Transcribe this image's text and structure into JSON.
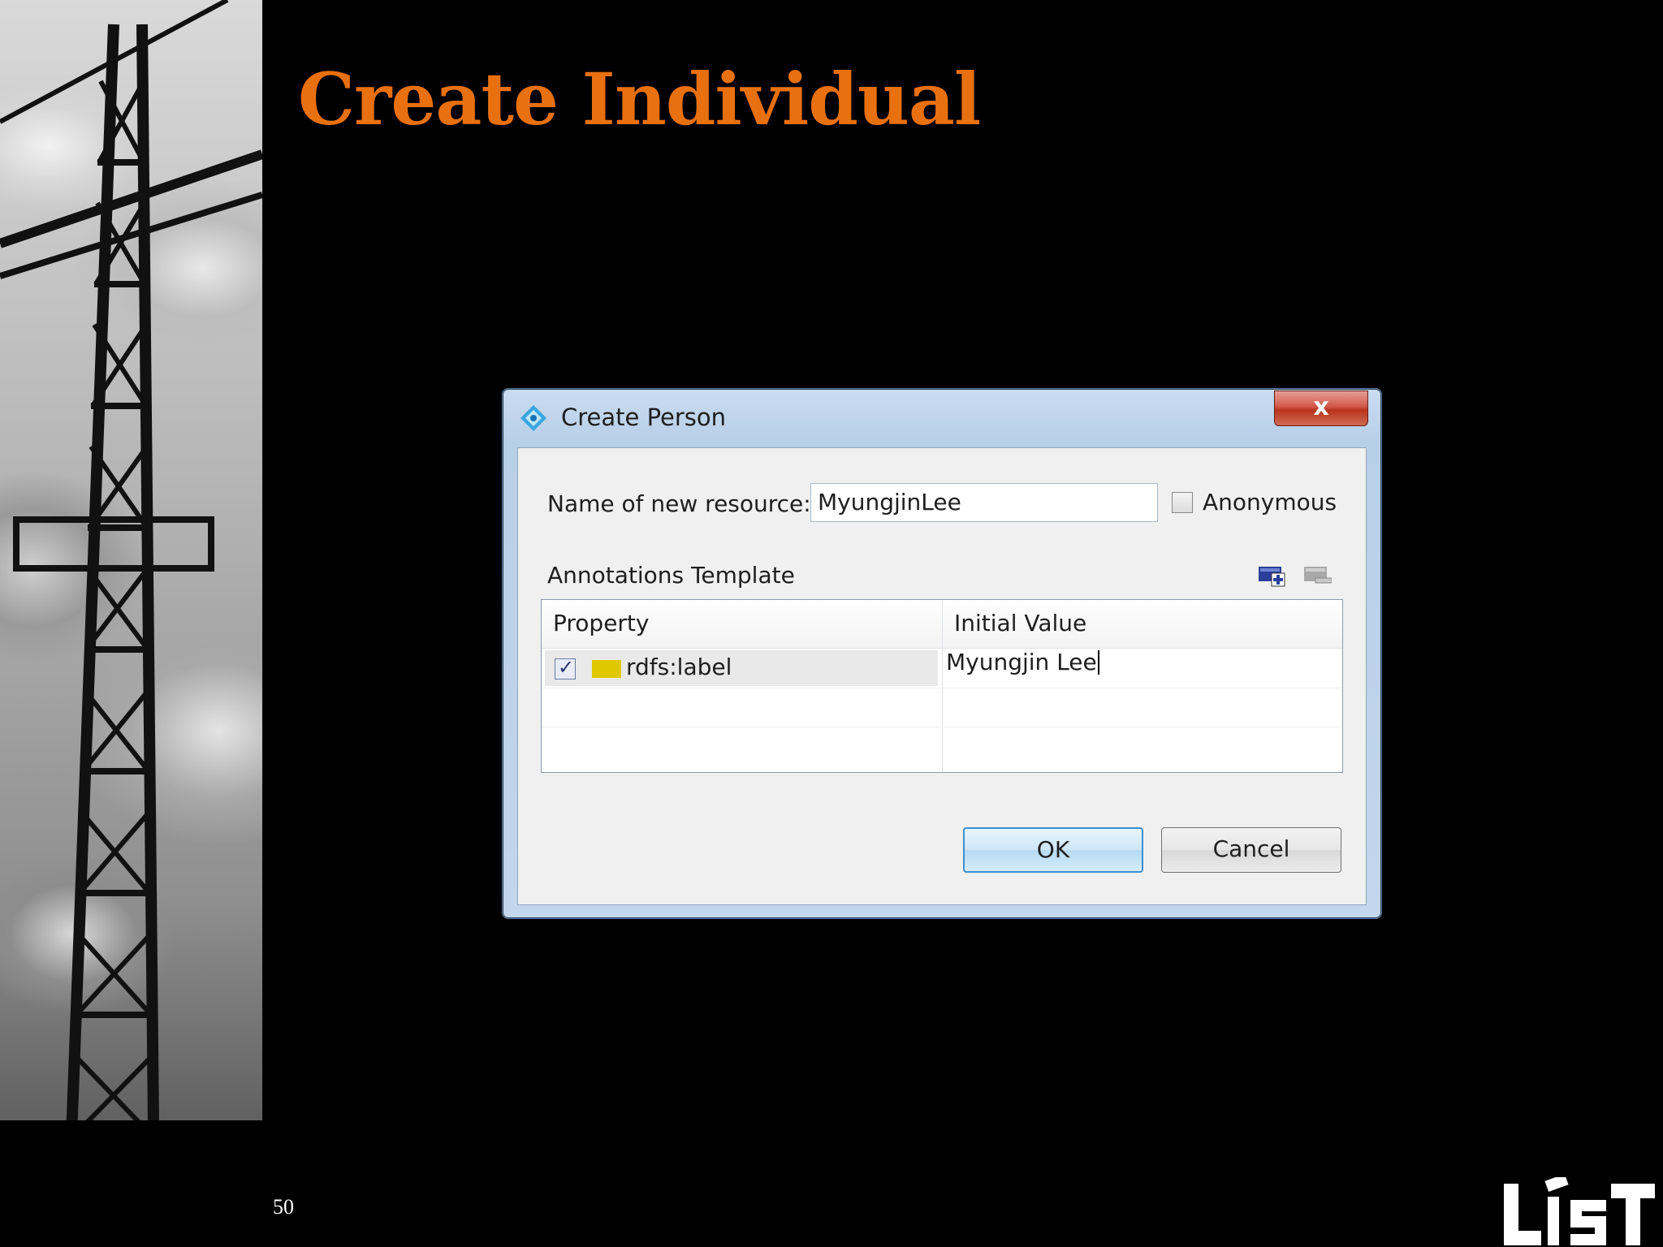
{
  "slide": {
    "title": "Create Individual",
    "page_number": "50",
    "logo_text": "LIST"
  },
  "dialog": {
    "title": "Create Person",
    "close_label": "x",
    "name_label": "Name of new resource:",
    "name_value": "MyungjinLee",
    "anonymous_label": "Anonymous",
    "anonymous_checked": false,
    "annotations_label": "Annotations Template",
    "table": {
      "columns": [
        "Property",
        "Initial Value"
      ],
      "rows": [
        {
          "checked": true,
          "property": "rdfs:label",
          "value": "Myungjin Lee"
        }
      ]
    },
    "ok_label": "OK",
    "cancel_label": "Cancel"
  },
  "colors": {
    "title": "#e8700f",
    "background": "#000000",
    "property_swatch": "#e0c800"
  },
  "icons": [
    "dialog-app-icon",
    "close-icon",
    "add-annotation-icon",
    "remove-annotation-icon"
  ]
}
